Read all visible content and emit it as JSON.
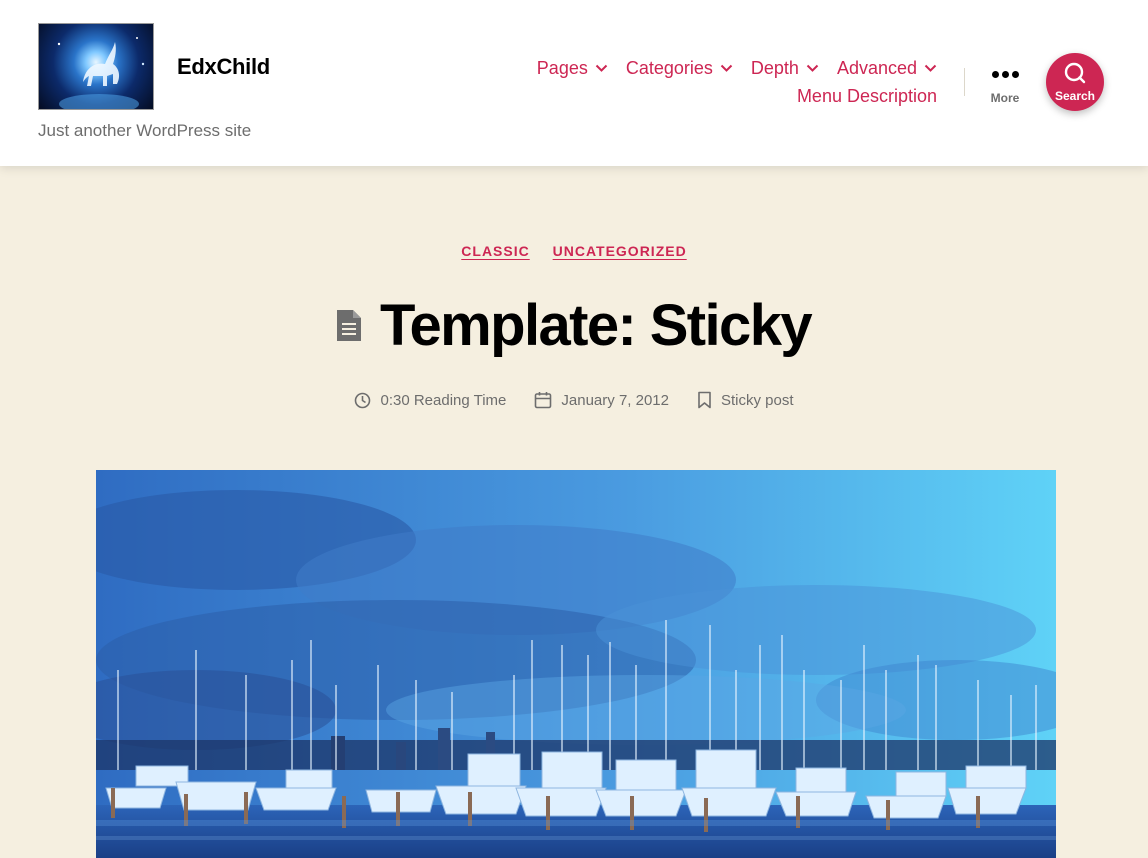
{
  "header": {
    "site_title": "EdxChild",
    "tagline": "Just another WordPress site",
    "menu": [
      {
        "label": "Pages",
        "has_submenu": true
      },
      {
        "label": "Categories",
        "has_submenu": true
      },
      {
        "label": "Depth",
        "has_submenu": true
      },
      {
        "label": "Advanced",
        "has_submenu": true
      },
      {
        "label": "Menu Description",
        "has_submenu": false
      }
    ],
    "more_label": "More",
    "search_label": "Search"
  },
  "entry": {
    "categories": [
      "CLASSIC",
      "UNCATEGORIZED"
    ],
    "title": "Template: Sticky",
    "meta": {
      "reading_time": "0:30 Reading Time",
      "date": "January 7, 2012",
      "sticky": "Sticky post"
    }
  },
  "icons": {
    "post_format": "document-icon",
    "reading_time": "clock-icon",
    "date": "calendar-icon",
    "sticky": "bookmark-icon",
    "more": "ellipsis-icon",
    "search": "search-icon",
    "submenu": "chevron-down-icon"
  },
  "colors": {
    "accent": "#cd2653",
    "background": "#f5efe0",
    "header_bg": "#ffffff",
    "text": "#000000",
    "secondary_text": "#6d6d6d"
  }
}
